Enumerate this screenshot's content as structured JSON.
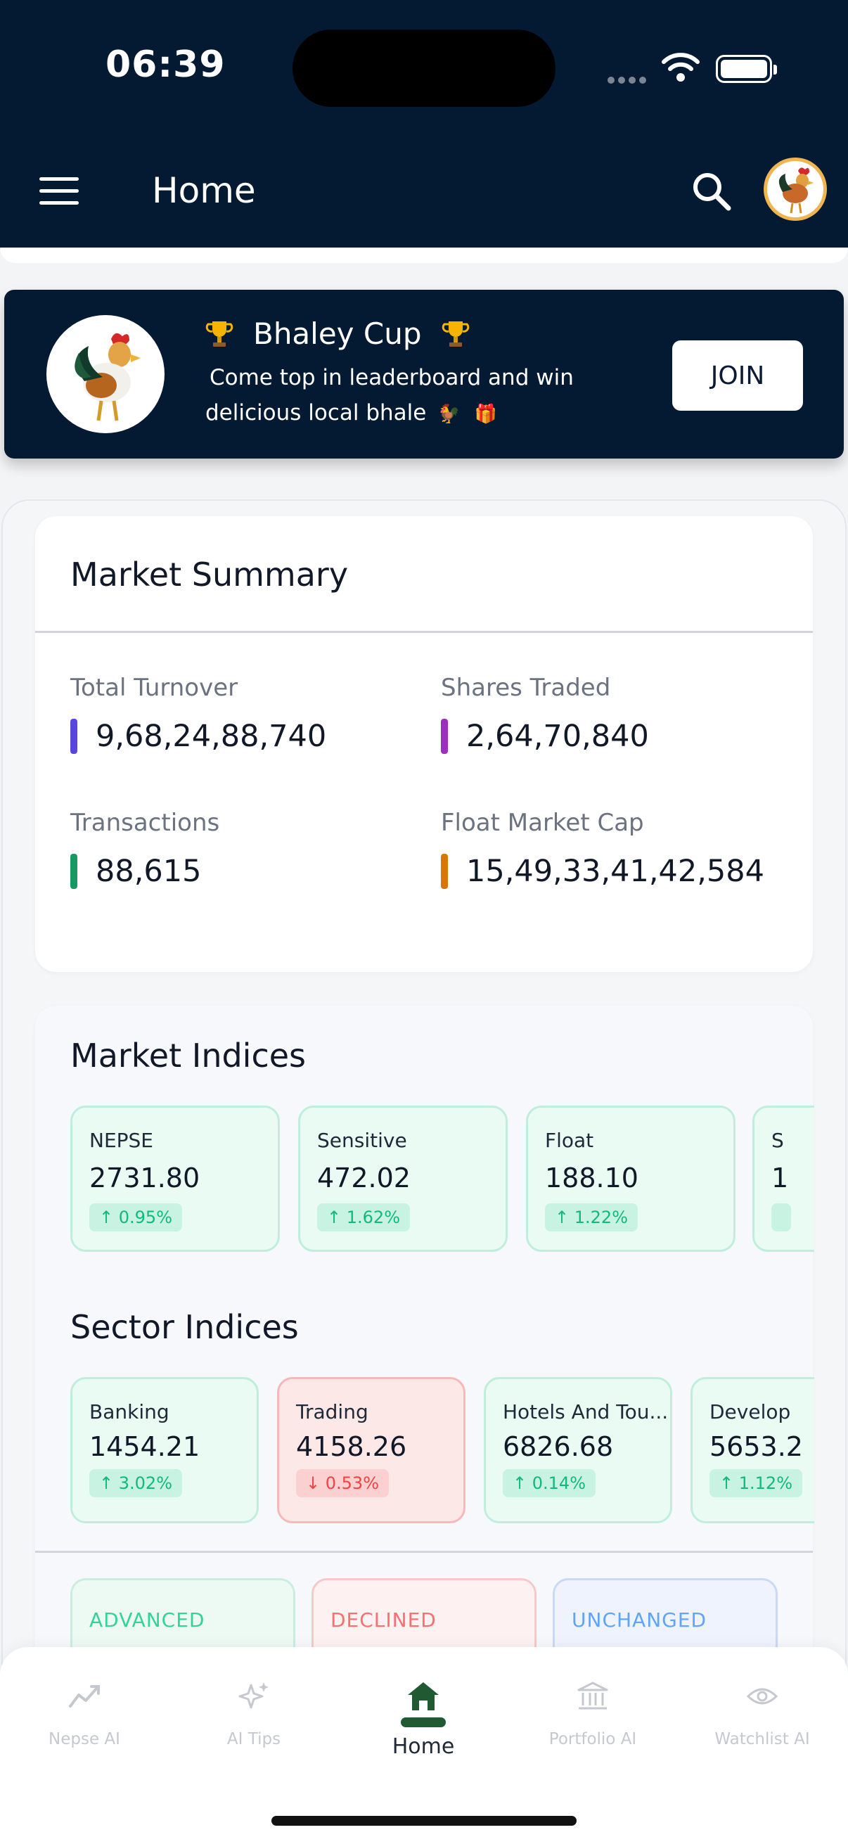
{
  "status_bar": {
    "time": "06:39"
  },
  "header": {
    "title": "Home",
    "menu_icon": "hamburger-menu-icon",
    "search_icon": "search-icon",
    "avatar_icon": "rooster-avatar"
  },
  "banner": {
    "title": "Bhaley Cup",
    "subtitle_line1": "Come top in leaderboard and win",
    "subtitle_line2": "delicious local bhale",
    "emoji_rooster": "🐓",
    "emoji_gift": "🎁",
    "join_label": "JOIN"
  },
  "market_summary": {
    "title": "Market Summary",
    "stats": [
      {
        "label": "Total Turnover",
        "value": "9,68,24,88,740",
        "color": "#5b45e0"
      },
      {
        "label": "Shares Traded",
        "value": "2,64,70,840",
        "color": "#9c2fbf"
      },
      {
        "label": "Transactions",
        "value": "88,615",
        "color": "#159b62"
      },
      {
        "label": "Float Market Cap",
        "value": "15,49,33,41,42,584",
        "color": "#d97706"
      }
    ]
  },
  "market_indices": {
    "title": "Market Indices",
    "items": [
      {
        "name": "NEPSE",
        "value": "2731.80",
        "change": "0.95%",
        "direction": "up"
      },
      {
        "name": "Sensitive",
        "value": "472.02",
        "change": "1.62%",
        "direction": "up"
      },
      {
        "name": "Float",
        "value": "188.10",
        "change": "1.22%",
        "direction": "up"
      },
      {
        "name": "S",
        "value": "1",
        "change": "",
        "direction": "up"
      }
    ]
  },
  "sector_indices": {
    "title": "Sector Indices",
    "items": [
      {
        "name": "Banking",
        "value": "1454.21",
        "change": "3.02%",
        "direction": "up"
      },
      {
        "name": "Trading",
        "value": "4158.26",
        "change": "0.53%",
        "direction": "down"
      },
      {
        "name": "Hotels And Tou...",
        "value": "6826.68",
        "change": "0.14%",
        "direction": "up"
      },
      {
        "name": "Develop",
        "value": "5653.2",
        "change": "1.12%",
        "direction": "up"
      }
    ]
  },
  "breadth": {
    "items": [
      {
        "label": "ADVANCED",
        "color": "#34d399"
      },
      {
        "label": "DECLINED",
        "color": "#f87171"
      },
      {
        "label": "UNCHANGED",
        "color": "#60a5fa"
      }
    ]
  },
  "bottom_nav": {
    "items": [
      {
        "label": "Nepse AI",
        "icon": "trend-line-icon"
      },
      {
        "label": "AI Tips",
        "icon": "sparkles-icon"
      },
      {
        "label": "Home",
        "icon": "home-icon",
        "active": true
      },
      {
        "label": "Portfolio AI",
        "icon": "bank-icon"
      },
      {
        "label": "Watchlist AI",
        "icon": "eye-icon"
      }
    ]
  },
  "colors": {
    "header_bg": "#041a33",
    "up": "#10b981",
    "down": "#ef4444",
    "active_nav": "#1f5a32"
  }
}
